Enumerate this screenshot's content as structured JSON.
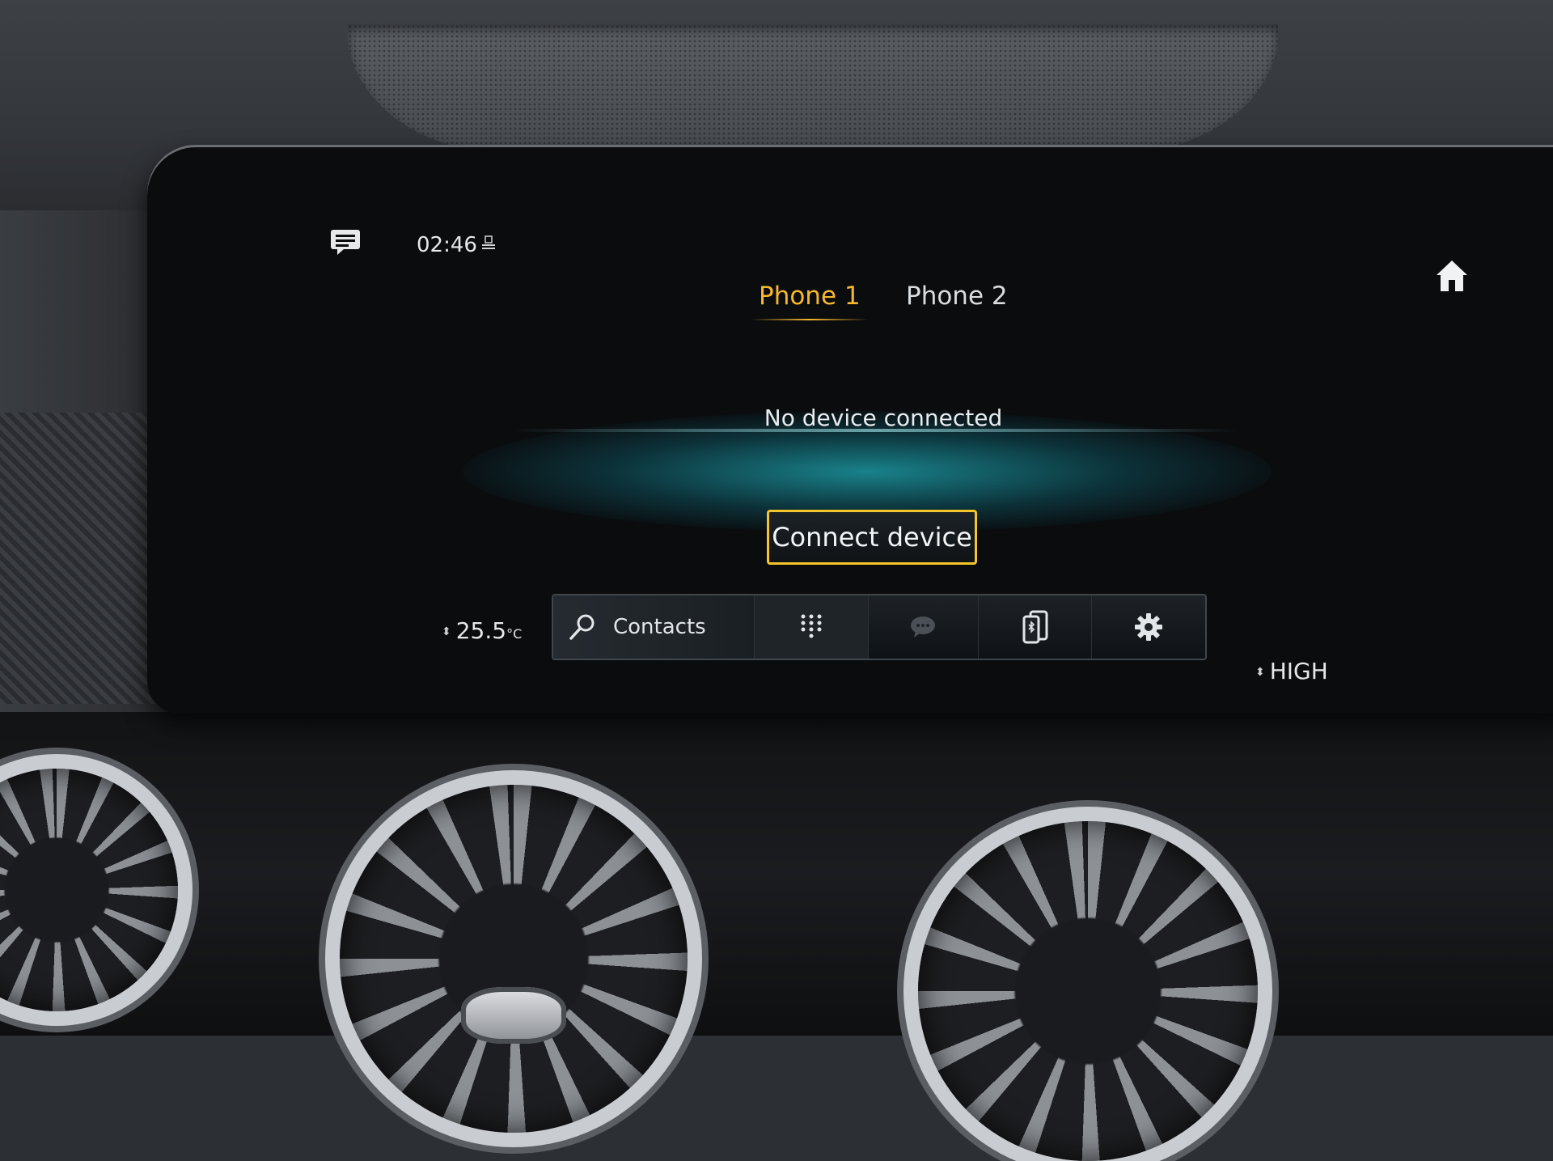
{
  "status_bar": {
    "time": "02:46",
    "network_icon": "4g-signal-icon",
    "messages_icon": "message-icon"
  },
  "home_icon": "home-icon",
  "tabs": [
    {
      "label": "Phone 1",
      "active": true
    },
    {
      "label": "Phone 2",
      "active": false
    }
  ],
  "main": {
    "status_text": "No device connected",
    "connect_button_label": "Connect device"
  },
  "toolbar": {
    "contacts_label": "Contacts",
    "items": [
      "search-icon",
      "dialpad-icon",
      "message-bubble-icon",
      "phone-device-icon",
      "gear-icon"
    ]
  },
  "climate": {
    "left_temp": "25.5",
    "left_temp_unit": "°C",
    "fan_level": "HIGH"
  },
  "colors": {
    "accent": "#f5b82e",
    "glow": "#1c96a0",
    "screen_bg": "#0a0c0e"
  }
}
